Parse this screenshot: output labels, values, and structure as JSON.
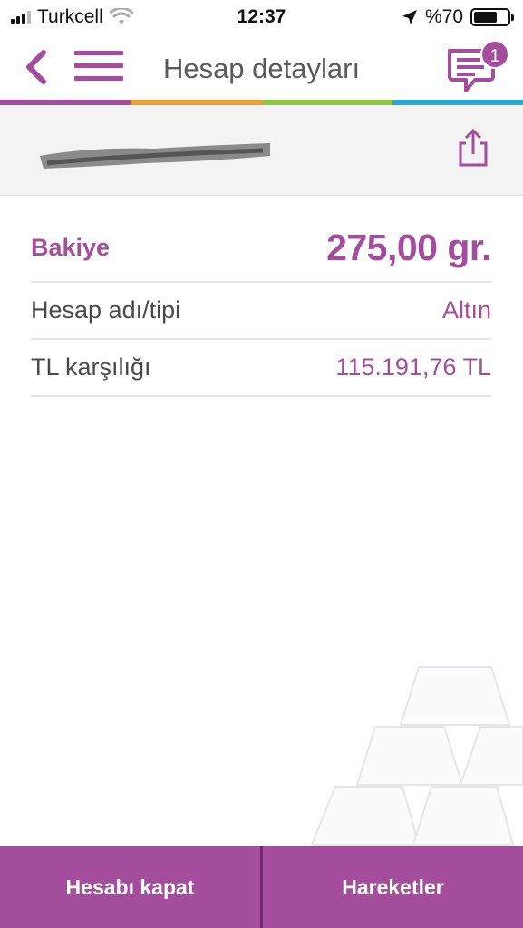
{
  "status_bar": {
    "carrier": "Turkcell",
    "time": "12:37",
    "battery_text": "%70",
    "battery_level": 0.7
  },
  "nav": {
    "title": "Hesap detayları",
    "message_badge": "1",
    "icons": {
      "back": "chevron-left-icon",
      "menu": "hamburger-menu-icon",
      "messages": "chat-bubble-icon"
    }
  },
  "stripe_colors": [
    "#a44d9c",
    "#f0a030",
    "#8dc63f",
    "#29a8e0"
  ],
  "account_header": {
    "share_icon": "share-icon"
  },
  "details": {
    "balance_label": "Bakiye",
    "balance_value": "275,00 gr.",
    "rows": [
      {
        "label": "Hesap adı/tipi",
        "value": "Altın"
      },
      {
        "label": "TL karşılığı",
        "value": "115.191,76 TL"
      }
    ]
  },
  "bottom_actions": {
    "close_account": "Hesabı kapat",
    "transactions": "Hareketler"
  },
  "colors": {
    "accent": "#a44d9c",
    "text": "#4a4a4a",
    "header_bg": "#f3f3f4"
  }
}
